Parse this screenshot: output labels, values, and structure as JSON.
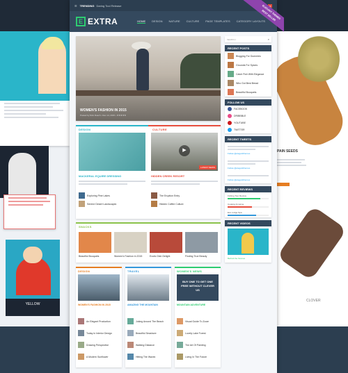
{
  "topbar": {
    "trending_label": "TRENDING",
    "trending_text": "Daring Tool Release",
    "social": [
      "f",
      "t",
      "g"
    ]
  },
  "brand": {
    "logo_letter": "E",
    "logo_text": "EXTRA"
  },
  "nav": [
    "HOME",
    "DESIGN",
    "NATURE",
    "CULTURE",
    "PAGE TEMPLATES",
    "CATEGORY LAYOUTS"
  ],
  "ribbon": {
    "line1": "ELEGANT THEMES",
    "line2": "BEST SELLER"
  },
  "hero": {
    "title": "WOMEN'S FASHION IN 2015",
    "meta": "Posted by Nick Roach • Dec 14, 2015 • ★★★★★"
  },
  "featured": {
    "design_label": "DESIGN",
    "culture_label": "CULTURE",
    "culture_badge": "LATEST NEWS",
    "left_title": "MACKERAL EQUIRE DRESSING",
    "right_title": "HIDDEN CREEK RESORT",
    "left_posts": [
      "Exploring Pine Lakes",
      "Serene Desert Landscapes"
    ],
    "right_posts": [
      "The Eruption Entry",
      "Hidden Coffee Culture"
    ]
  },
  "strip": {
    "label": "SNACKS",
    "items": [
      "Beautiful Bouquets",
      "Women's Fashion in 2015",
      "Exotic Dish Delight",
      "Finding True Beauty"
    ]
  },
  "bottom": {
    "cols": [
      {
        "label": "DESIGN",
        "title": "WOMEN'S FASHION IN 2015",
        "posts": [
          "An Elegant Production",
          "Today in Interior Design",
          "Drawing Perspective",
          "A Modern Sunflower"
        ]
      },
      {
        "label": "TRAVEL",
        "title": "AMAZING THE MOUNTAIN",
        "posts": [
          "Joking Around The Beach",
          "Beautiful Seashore",
          "Walking Distance",
          "Hitting The Waves"
        ]
      },
      {
        "label": "WOMEN'S NEWS",
        "banner": "BUY ONE TO GET ONE FREE WITHOUT CLEVER US",
        "title": "MOUNTAIN ADVENTURE",
        "posts": [
          "Visual Guide To Zoom",
          "Lovely Lake Forest",
          "The Art Of Painting",
          "Living In The Future"
        ]
      }
    ]
  },
  "sidebar": {
    "search_placeholder": "SEARCH",
    "recent_posts_label": "RECENT POSTS",
    "recent_posts": [
      "Blogging For Dummies",
      "Grounds For Spices",
      "Catch Fish With Elegance",
      "Who Got Best Bread",
      "Beautiful Bouquets"
    ],
    "follow_label": "FOLLOW US",
    "follow": [
      {
        "name": "FACEBOOK",
        "color": "#3b5998"
      },
      {
        "name": "DRIBBBLE",
        "color": "#ea4c89"
      },
      {
        "name": "YOUTUBE",
        "color": "#cc181e"
      },
      {
        "name": "TWITTER",
        "color": "#1da1f2"
      }
    ],
    "tweets_label": "RECENT TWEETS",
    "tweets": [
      "Follow @elegantthemes",
      "Follow @elegantthemes",
      "Follow @elegantthemes"
    ],
    "reviews_label": "RECENT REVIEWS",
    "reviews": [
      {
        "name": "Fishing Tour Review",
        "pct": 0.8,
        "color": "#2ecc71"
      },
      {
        "name": "Cooking At Home",
        "pct": 0.6,
        "color": "#e74c3c"
      },
      {
        "name": "Eco Lodge Spa",
        "pct": 0.7,
        "color": "#3498db"
      }
    ],
    "videos_label": "RECENT VIDEOS",
    "video_caption": "Behind the Scenes"
  },
  "left_mock": {
    "sig_text": "PAIN SEEDS",
    "yellow_label": "YELLOW",
    "clover": "CLOVER"
  },
  "colors": {
    "accent": "#2ecc71",
    "dark": "#2c3e50",
    "nav": "#34495e"
  }
}
